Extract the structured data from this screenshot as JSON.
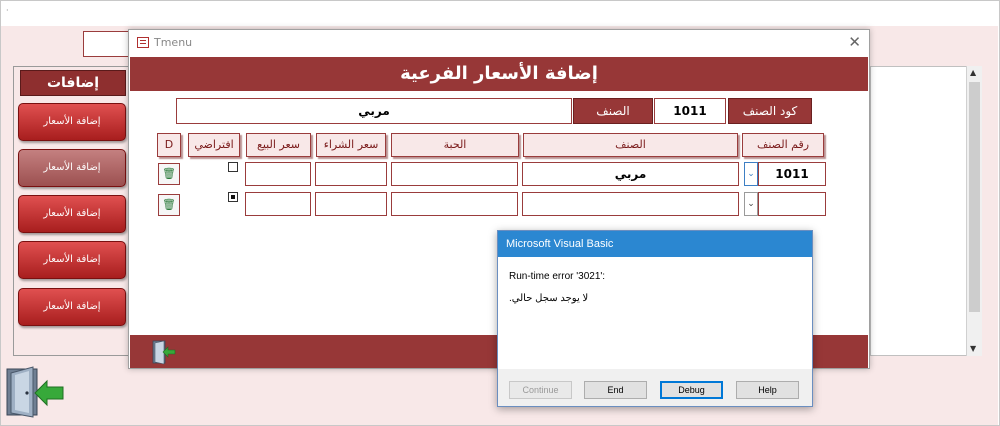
{
  "window": {
    "marker": "·",
    "title": "Tmenu",
    "close_glyph": "✕"
  },
  "form": {
    "header": "إضافة الأسعار الفرعية",
    "item_code_label": "كود الصنف",
    "item_code_value": "1011",
    "item_label": "الصنف",
    "item_name_value": "مربي"
  },
  "table": {
    "columns": [
      "رقم الصنف",
      "الصنف",
      "الحبة",
      "سعر الشراء",
      "سعر البيع",
      "افتراضي",
      "D"
    ],
    "rows": [
      {
        "item_no": "1011",
        "item": "مربي",
        "unit": "",
        "purchase_price": "",
        "sale_price": "",
        "default_checked": false
      },
      {
        "item_no": "",
        "item": "",
        "unit": "",
        "purchase_price": "",
        "sale_price": "",
        "default_checked": true
      }
    ],
    "combo_arrow": "⌄",
    "delete_icon": "🗑"
  },
  "sidebar": {
    "title": "إضافات",
    "buttons": [
      "إضافة الأسعار",
      "إضافة الأسعار",
      "إضافة الأسعار",
      "إضافة الأسعار",
      "إضافة الأسعار"
    ]
  },
  "scrollbar": {
    "up": "▲",
    "down": "▼"
  },
  "dialog": {
    "title": "Microsoft Visual Basic",
    "error_line": "Run-time error '3021':",
    "message": ".لا يوجد سجل حالي",
    "buttons": {
      "continue": "Continue",
      "end": "End",
      "debug": "Debug",
      "help": "Help"
    }
  },
  "colors": {
    "accent": "#973737",
    "background": "#f8e8e8",
    "dialog_title": "#2b87d1"
  }
}
